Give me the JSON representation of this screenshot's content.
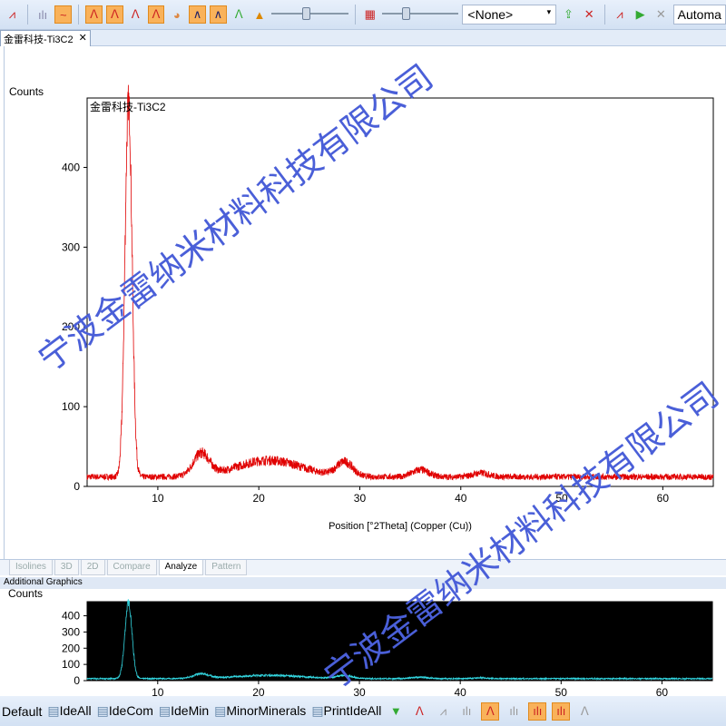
{
  "toolbar": {
    "style_combo": "<None>",
    "mode_field": "Automa"
  },
  "document_tab": {
    "label": "金雷科技-Ti3C2"
  },
  "main_chart": {
    "ylabel": "Counts",
    "xlabel": "Position [°2Theta] (Copper (Cu))",
    "legend": "金雷科技-Ti3C2",
    "yticks": [
      "0",
      "100",
      "200",
      "300",
      "400"
    ],
    "xticks": [
      "10",
      "20",
      "30",
      "40",
      "50",
      "60"
    ],
    "color": "#e00000"
  },
  "view_tabs": [
    "Isolines",
    "3D",
    "2D",
    "Compare",
    "Analyze",
    "Pattern"
  ],
  "additional_graphics": {
    "title": "Additional Graphics",
    "ylabel": "Counts",
    "yticks": [
      "0",
      "100",
      "200",
      "300",
      "400"
    ],
    "xticks": [
      "10",
      "20",
      "30",
      "40",
      "50",
      "60"
    ],
    "color": "#33d6e0"
  },
  "statusbar": {
    "items": [
      "Default",
      "IdeAll",
      "IdeCom",
      "IdeMin",
      "MinorMinerals",
      "PrintIdeAll"
    ]
  },
  "watermark": "宁波金雷纳米材料科技有限公司",
  "chart_data": {
    "type": "line",
    "title": "金雷科技-Ti3C2",
    "xlabel": "Position [°2Theta] (Copper (Cu))",
    "ylabel": "Counts",
    "xlim": [
      3,
      65
    ],
    "ylim": [
      0,
      487
    ],
    "peaks": [
      {
        "x": 7.1,
        "y": 470
      },
      {
        "x": 14.3,
        "y": 35
      },
      {
        "x": 21,
        "y": 28
      },
      {
        "x": 28.5,
        "y": 25
      },
      {
        "x": 36,
        "y": 16
      },
      {
        "x": 42,
        "y": 12
      }
    ],
    "background": 12
  }
}
